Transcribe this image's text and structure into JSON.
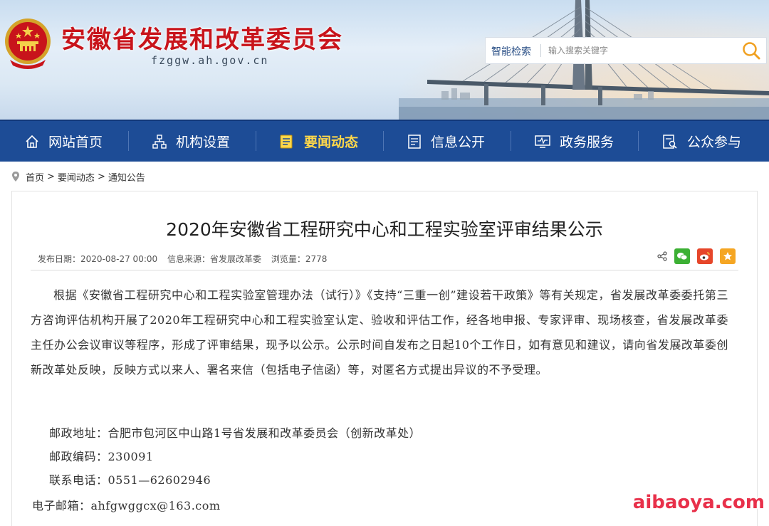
{
  "header": {
    "site_title": "安徽省发展和改革委员会",
    "domain": "fzggw.ah.gov.cn",
    "search_label": "智能检索",
    "search_placeholder": "输入搜索关键字"
  },
  "nav": {
    "items": [
      {
        "label": "网站首页",
        "icon": "home-icon"
      },
      {
        "label": "机构设置",
        "icon": "org-chart-icon"
      },
      {
        "label": "要闻动态",
        "icon": "news-icon",
        "active": true
      },
      {
        "label": "信息公开",
        "icon": "document-icon"
      },
      {
        "label": "政务服务",
        "icon": "monitor-icon"
      },
      {
        "label": "公众参与",
        "icon": "search-doc-icon"
      }
    ],
    "active_color": "#ffd84a",
    "bg_color": "#1d4c96"
  },
  "breadcrumb": [
    "首页",
    "要闻动态",
    "通知公告"
  ],
  "article": {
    "title": "2020年安徽省工程研究中心和工程实验室评审结果公示",
    "publish_date": "发布日期：2020-08-27 00:00",
    "source": "信息来源：省发展改革委",
    "views": "浏览量：2778",
    "paragraph": "根据《安徽省工程研究中心和工程实验室管理办法（试行）》《支持“三重一创”建设若干政策》等有关规定，省发展改革委委托第三方咨询评估机构开展了2020年工程研究中心和工程实验室认定、验收和评估工作，经各地申报、专家评审、现场核查，省发展改革委主任办公会议审议等程序，形成了评审结果，现予以公示。公示时间自发布之日起10个工作日，如有意见和建议，请向省发展改革委创新改革处反映，反映方式以来人、署名来信（包括电子信函）等，对匿名方式提出异议的不予受理。",
    "address": "邮政地址：合肥市包河区中山路1号省发展和改革委员会（创新改革处）",
    "postcode": "邮政编码：230091",
    "phone": "联系电话：0551—62602946",
    "email": "电子邮箱：ahfgwggcx@163.com"
  },
  "watermark": "aibaoya.com"
}
